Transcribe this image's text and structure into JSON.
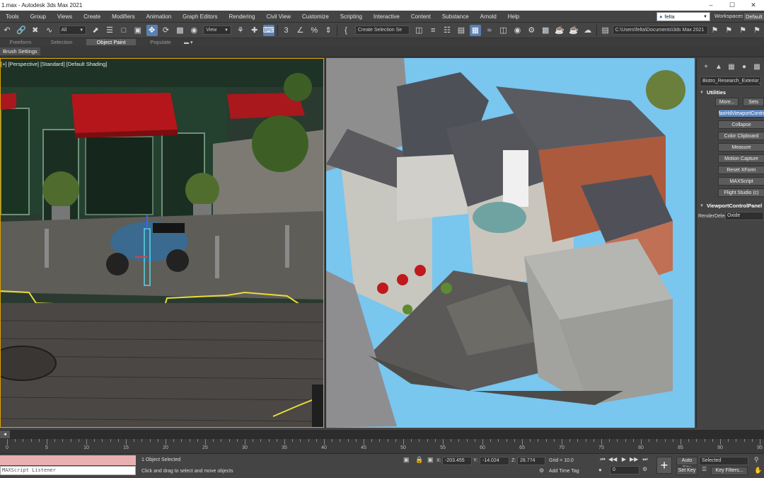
{
  "window": {
    "title": "1.max - Autodesk 3ds Max 2021",
    "controls": [
      "–",
      "☐",
      "✕"
    ]
  },
  "menu": [
    "Tools",
    "Group",
    "Views",
    "Create",
    "Modifiers",
    "Animation",
    "Graph Editors",
    "Rendering",
    "Civil View",
    "Customize",
    "Scripting",
    "Interactive",
    "Content",
    "Substance",
    "Arnold",
    "Help"
  ],
  "user": {
    "name": "felta"
  },
  "workspace": {
    "label": "Workspaces:",
    "value": "Default"
  },
  "toolbar": {
    "selection_filter": "All",
    "ref_coord": "View",
    "named_selection": "Create Selection Se",
    "project_path": "C:\\Users\\felta\\Documents\\3ds Max 2021"
  },
  "ribbon": {
    "tabs": [
      "Freeform",
      "Selection",
      "Object Paint",
      "Populate"
    ],
    "active_tab": "Object Paint",
    "brush_settings": "Brush Settings"
  },
  "viewport_left": {
    "label": "[+] [Perspective] [Standard] [Default Shading]"
  },
  "command_panel": {
    "object_name": "Bistro_Research_Exterior_Paris",
    "utilities_title": "Utilities",
    "more_button": "More...",
    "sets_button": "Sets",
    "utilities": [
      "MaxHdViewportControl",
      "Collapse",
      "Color Clipboard",
      "Measure",
      "Motion Capture",
      "Reset XForm",
      "MAXScript",
      "Flight Studio (c)"
    ],
    "highlighted_utility": "MaxHdViewportControl",
    "viewport_panel_title": "ViewportControlPanel",
    "render_delegate_label": "RenderDelegate",
    "render_delegate_value": "Oxide"
  },
  "timeline": {
    "slider": "0 / 100",
    "ticks": [
      "0",
      "5",
      "10",
      "15",
      "20",
      "25",
      "30",
      "35",
      "40",
      "45",
      "50",
      "55",
      "60",
      "65",
      "70",
      "75",
      "80",
      "85",
      "90",
      "95"
    ]
  },
  "status": {
    "listener_text": "MAXScript Listener",
    "selection_count": "1 Object Selected",
    "prompt": "Click and drag to select and move objects",
    "x_label": "X:",
    "x_value": "-203.455",
    "y_label": "Y:",
    "y_value": "-14.024",
    "z_label": "Z:",
    "z_value": "28.774",
    "grid": "Grid = 10.0",
    "add_time_tag": "Add Time Tag",
    "frame_value": "0",
    "auto_key": "Auto Key",
    "set_key": "Set Key",
    "key_mode": "Selected",
    "key_filters": "Key Filters..."
  }
}
